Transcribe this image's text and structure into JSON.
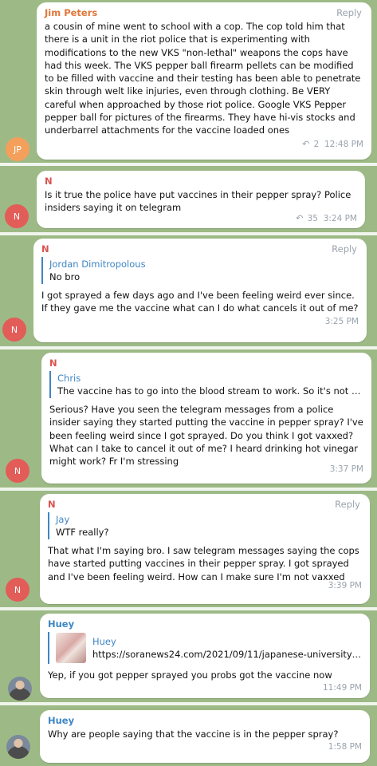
{
  "colors": {
    "background": "#9dba86",
    "jim_name": "#e0763a",
    "n_name": "#d9534f",
    "huey_name": "#3f86c4",
    "link": "#3f86c4",
    "meta": "#9aa3ad"
  },
  "messages": [
    {
      "sender": "Jim Peters",
      "reply_label": "Reply",
      "avatar_initials": "JP",
      "text": "a cousin of mine went to school with a cop.  The cop told him that there is a unit in the riot police that is experimenting with modifications to the new VKS \"non-lethal\" weapons the cops have had this week. The VKS pepper ball firearm pellets can be modified to be filled with vaccine and their testing has been able to penetrate skin through welt like injuries, even through clothing. Be VERY careful when approached by those riot police. Google VKS Pepper pepper ball for pictures of the firearms. They have hi-vis stocks and underbarrel attachments for the vaccine loaded ones",
      "forward_icon": "share-arrow-icon",
      "forwards": "2",
      "time": "12:48 PM"
    },
    {
      "sender": "N",
      "avatar_initials": "N",
      "text": "Is it true the police have put vaccines in their pepper spray? Police insiders saying it on telegram",
      "forward_icon": "share-arrow-icon",
      "forwards": "35",
      "time": "3:24 PM"
    },
    {
      "sender": "N",
      "reply_label": "Reply",
      "avatar_initials": "N",
      "quote_name": "Jordan Dimitropolous",
      "quote_text": "No bro",
      "text": "I got sprayed a few days ago and I've been feeling weird ever since. If they gave me the vaccine what can I do what cancels it out of me?",
      "time": "3:25 PM"
    },
    {
      "sender": "N",
      "avatar_initials": "N",
      "quote_name": "Chris",
      "quote_text": "The vaccine has to go into the blood stream to work. So it's not p...",
      "text": "Serious? Have you seen the telegram messages from a police insider saying they started putting the vaccine in pepper spray? I've been feeling weird since I got sprayed. Do you think I got vaxxed? What can I take to cancel it out of me? I heard drinking hot vinegar might work? Fr I'm stressing",
      "time": "3:37 PM"
    },
    {
      "sender": "N",
      "reply_label": "Reply",
      "avatar_initials": "N",
      "quote_name": "Jay",
      "quote_text": "WTF really?",
      "text": "That what I'm saying bro. I saw telegram messages saying the cops have started putting vaccines in their pepper spray. I got sprayed and I've been feeling weird. How can I make sure I'm not vaxxed",
      "time": "3:39 PM"
    },
    {
      "sender": "Huey",
      "quote_name": "Huey",
      "quote_text": "https://soranews24.com/2021/09/11/japanese-university-...",
      "text": "Yep, if you got pepper sprayed you probs got the vaccine now",
      "time": "11:49 PM"
    },
    {
      "sender": "Huey",
      "text": "Why are people saying that the vaccine is in the pepper spray?",
      "time": "1:58 PM"
    }
  ]
}
